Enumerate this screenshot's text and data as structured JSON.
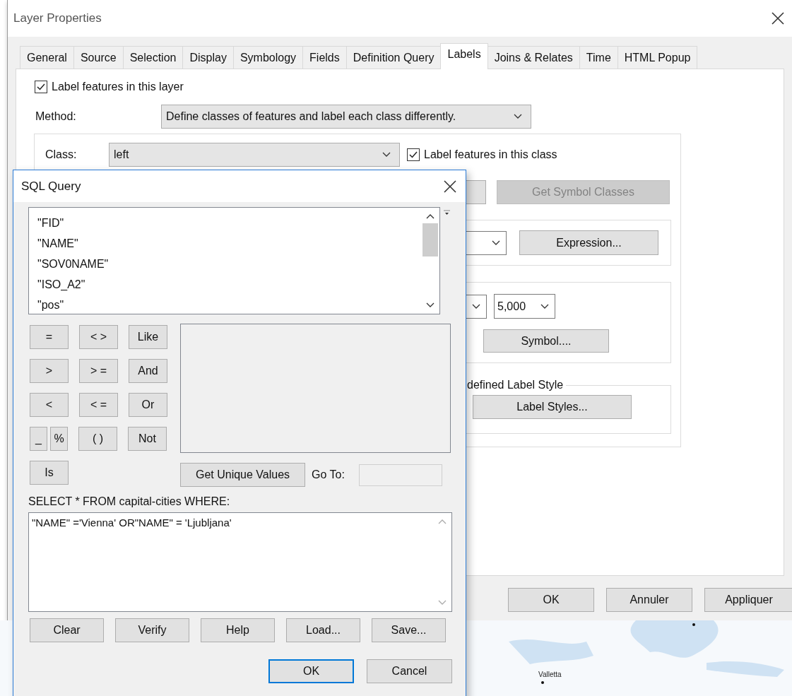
{
  "window": {
    "title": "Layer Properties"
  },
  "tabs": [
    {
      "label": "General",
      "selected": false
    },
    {
      "label": "Source",
      "selected": false
    },
    {
      "label": "Selection",
      "selected": false
    },
    {
      "label": "Display",
      "selected": false
    },
    {
      "label": "Symbology",
      "selected": false
    },
    {
      "label": "Fields",
      "selected": false
    },
    {
      "label": "Definition Query",
      "selected": false
    },
    {
      "label": "Labels",
      "selected": true
    },
    {
      "label": "Joins & Relates",
      "selected": false
    },
    {
      "label": "Time",
      "selected": false
    },
    {
      "label": "HTML Popup",
      "selected": false
    }
  ],
  "label_features_layer": {
    "label": "Label features in this layer",
    "checked": true
  },
  "method": {
    "label": "Method:",
    "value": "Define classes of features and label each class differently."
  },
  "class": {
    "label": "Class:",
    "value": "left",
    "label_features_class": {
      "label": "Label features in this class",
      "checked": true
    }
  },
  "get_symbol_classes": {
    "label": "Get Symbol Classes",
    "disabled": true
  },
  "expression_button": "Expression...",
  "scale_value": "5,000",
  "symbol_button": "Symbol....",
  "label_style_group": {
    "legend": "defined Label Style",
    "button": "Label Styles..."
  },
  "footer_buttons": [
    "OK",
    "Annuler",
    "Appliquer"
  ],
  "sql_dialog": {
    "title": "SQL Query",
    "fields": [
      "\"FID\"",
      "\"NAME\"",
      "\"SOV0NAME\"",
      "\"ISO_A2\"",
      "\"pos\""
    ],
    "operator_rows": [
      [
        {
          "label": "=",
          "kind": "full"
        },
        {
          "label": "< >",
          "kind": "full"
        },
        {
          "label": "Like",
          "kind": "full"
        }
      ],
      [
        {
          "label": ">",
          "kind": "full"
        },
        {
          "label": "> =",
          "kind": "full"
        },
        {
          "label": "And",
          "kind": "full"
        }
      ],
      [
        {
          "label": "<",
          "kind": "full"
        },
        {
          "label": "< =",
          "kind": "full"
        },
        {
          "label": "Or",
          "kind": "full"
        }
      ],
      [
        {
          "label": "_",
          "kind": "half"
        },
        {
          "label": "%",
          "kind": "half"
        },
        {
          "label": "( )",
          "kind": "full"
        },
        {
          "label": "Not",
          "kind": "full"
        }
      ],
      [
        {
          "label": "Is",
          "kind": "full"
        }
      ]
    ],
    "get_unique_values": "Get Unique Values",
    "goto_label": "Go To:",
    "select_label": "SELECT * FROM capital-cities WHERE:",
    "expression": "\"NAME\" ='Vienna' OR\"NAME\" = 'Ljubljana'",
    "actions": [
      "Clear",
      "Verify",
      "Help",
      "Load...",
      "Save..."
    ],
    "buttons": [
      {
        "label": "OK",
        "default": true
      },
      {
        "label": "Cancel",
        "default": false
      }
    ]
  },
  "map": {
    "labels": [
      "Valletta"
    ]
  }
}
